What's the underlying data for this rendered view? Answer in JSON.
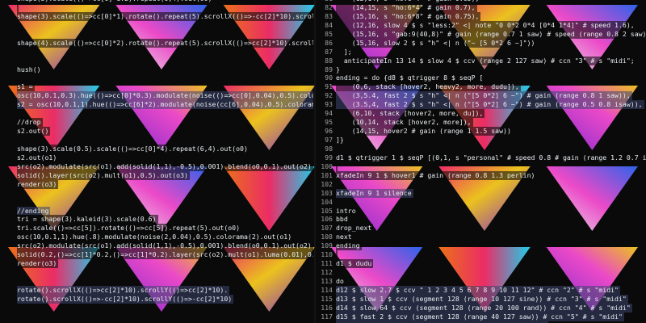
{
  "editor": {
    "left_lines": [
      {
        "n": "",
        "t": "shape(3).scale(()=>cc[0]*1.2).repeat(6,4).out(o0)"
      },
      {
        "n": "",
        "t": ""
      },
      {
        "n": "",
        "t": "shape(3).scale(()=>cc[0]*1).rotate().repeat(5).scrollX(()=>-cc[2]*10).scrollY(()=>-cc[2]*10).out(o0)"
      },
      {
        "n": "",
        "t": ""
      },
      {
        "n": "",
        "t": ""
      },
      {
        "n": "",
        "t": "shape(4).scale(()=>cc[0]*2).rotate().repeat(5).scrollX(()=>cc[2]*10).scrollY(()=>cc[2]*10).out()"
      },
      {
        "n": "",
        "t": ""
      },
      {
        "n": "",
        "t": ""
      },
      {
        "n": "",
        "t": "hush()"
      },
      {
        "n": "",
        "t": ""
      },
      {
        "n": "",
        "t": "s1 ="
      },
      {
        "n": "",
        "t": "osc(10,0.1,0.3).hue(()=>cc[0]*0.3).modulate(noise(()=>cc[0],0.04),0.5).colorama(0.5)"
      },
      {
        "n": "",
        "t": "s2 = osc(10,0.1,1).hue(()=>cc[6]*2).modulate(noise(cc[6],0.04),0.5).colorama(1)"
      },
      {
        "n": "",
        "t": ""
      },
      {
        "n": "",
        "t": "//drop"
      },
      {
        "n": "",
        "t": "s2.out()"
      },
      {
        "n": "",
        "t": ""
      },
      {
        "n": "",
        "t": "shape(3).scale(0.5).scale(()=>cc[0]*4).repeat(6,4).out(o0)"
      },
      {
        "n": "",
        "t": "s2.out(o1)"
      },
      {
        "n": "",
        "t": "src(o2).modulate(src(o1).add(solid(1,1),-0.5),0.001).blend(o0,0.1).out(o2)"
      },
      {
        "n": "",
        "t": "solid().layer(src(o2).mult(o1),0.5).out(o3)"
      },
      {
        "n": "",
        "t": "render(o3)"
      },
      {
        "n": "",
        "t": ""
      },
      {
        "n": "",
        "t": ""
      },
      {
        "n": "",
        "t": "//ending"
      },
      {
        "n": "",
        "t": "tri = shape(3).kaleid(3).scale(0.6)"
      },
      {
        "n": "",
        "t": "tri.scale(()=>cc[5]).rotate(()=>cc[5]).repeat(5).out(o0)"
      },
      {
        "n": "",
        "t": "osc(10,0.1,1).hue(.8).modulate(noise(2,0.04),0.5).colorama(2).out(o1)"
      },
      {
        "n": "",
        "t": "src(o2).modulate(src(o1).add(solid(1,1),-0.5),0.001).blend(o0,0.1).out(o2)"
      },
      {
        "n": "",
        "t": "solid(0.2,()=>cc[1]*0.2,()=>cc[1]*0.2).layer(src(o2).mult(o1).luma(0.01),0.1).out(o3)"
      },
      {
        "n": "",
        "t": "render(o3)"
      },
      {
        "n": "",
        "t": ""
      },
      {
        "n": "",
        "t": ""
      },
      {
        "n": "",
        "t": "rotate().scrollX(()=>cc[2]*10).scrollY(()=>cc[2]*10)."
      },
      {
        "n": "",
        "t": "rotate().scrollX(()=>-cc[2]*10).scrollY(()=>-cc[2]*10)"
      },
      {
        "n": "",
        "t": ""
      },
      {
        "n": "",
        "t": ""
      },
      {
        "n": "",
        "t": "hush()"
      }
    ],
    "right_lines": [
      {
        "n": "81",
        "t": "    (12,14, s \"ho:6*4\" # gain 0.65),"
      },
      {
        "n": "82",
        "t": "    (14,15, s \"ho:6*4\" # gain 0.7),"
      },
      {
        "n": "83",
        "t": "    (15,16, s \"ho:6*8\" # gain 0.75),"
      },
      {
        "n": "84",
        "t": "    (12,16, slow 4 $ s \"less:2\" <| note \"0 0*2 0*4 [0*4 1*4]\" # speed 1.6),"
      },
      {
        "n": "85",
        "t": "    (15,16, s \"gab:9(40,8)\" # gain (range 0.7 1 saw) # speed (range 0.8 2 saw) # cut 1),"
      },
      {
        "n": "86",
        "t": "    (15,16, slow 2 $ s \"h\" <| n (\"~ [5 0*2 6 ~]\"))"
      },
      {
        "n": "87",
        "t": "  ];"
      },
      {
        "n": "88",
        "t": "  anticipateIn 13 14 $ slow 4 $ ccv (range 2 127 saw) # ccn \"3\" # s \"midi\";"
      },
      {
        "n": "89",
        "t": "}"
      },
      {
        "n": "90",
        "t": "ending = do {d8 $ qtrigger 8 $ seqP ["
      },
      {
        "n": "91",
        "t": "    (0,6, stack [hover2, heavy2, more, dudu]),"
      },
      {
        "n": "92",
        "t": "    (3,5.4, fast 2 $ s \"h\" <| n (\"[5 0*2] 6 ~\") # gain (range 0.8 1 saw)),"
      },
      {
        "n": "93",
        "t": "    (3.5,4, fast 2 $ s \"h\" <| n (\"[5 0*2] 6 ~\") # gain (range 0.5 0.8 isaw)),"
      },
      {
        "n": "94",
        "t": "    (6,10, stack [hover2, more, du]),"
      },
      {
        "n": "95",
        "t": "    (10,14, stack [hover2, more]),"
      },
      {
        "n": "96",
        "t": "    (14,15, hover2 # gain (range 1 1.5 saw))"
      },
      {
        "n": "97",
        "t": "]}"
      },
      {
        "n": "98",
        "t": ""
      },
      {
        "n": "99",
        "t": "d1 $ qtrigger 1 $ seqP [(0,1, s \"personal\" # speed 0.8 # gain (range 1.2 0.7 isaw))]"
      },
      {
        "n": "100",
        "t": ""
      },
      {
        "n": "101",
        "t": "xfadeIn 9 1 $ hover1 # gain (range 0.8 1.3 perlin)"
      },
      {
        "n": "102",
        "t": ""
      },
      {
        "n": "103",
        "t": "xfadeIn 9 1 silence"
      },
      {
        "n": "104",
        "t": ""
      },
      {
        "n": "105",
        "t": "intro"
      },
      {
        "n": "106",
        "t": "bbd"
      },
      {
        "n": "107",
        "t": "drop_next"
      },
      {
        "n": "108",
        "t": "next"
      },
      {
        "n": "109",
        "t": "ending"
      },
      {
        "n": "110",
        "t": ""
      },
      {
        "n": "111",
        "t": "d1 $ dudu"
      },
      {
        "n": "112",
        "t": ""
      },
      {
        "n": "113",
        "t": "do"
      },
      {
        "n": "114",
        "t": "d12 $ slow 2.7 $ ccv \" 1 2 3 4 5 6 7 8 9 10 11 12\" # ccn \"2\" # s \"midi\""
      },
      {
        "n": "115",
        "t": "d13 $ slow 1 $ ccv (segment 128 (range 10 127 sine)) # ccn \"3\" # s \"midi\""
      },
      {
        "n": "116",
        "t": "d14 $ slow 64 $ ccv (segment 128 (range 20 100 rand)) # ccn \"4\" # s \"midi\""
      },
      {
        "n": "117",
        "t": "d15 $ fast 2 $ ccv (segment 128 (range 40 127 saw)) # ccn \"5\" # s \"midi\""
      },
      {
        "n": "118",
        "t": "d16 $ slow 2 $ ccv \"50 30 80 10\" # ccn \"6\" # s \"midi\""
      }
    ],
    "highlighted_left": [
      11,
      12,
      24,
      33,
      34
    ],
    "highlighted_right": [
      92,
      93,
      103,
      114,
      115,
      116,
      117,
      118
    ]
  },
  "visual": {
    "palette": [
      "#ff2f6e",
      "#ff7a1a",
      "#ffd21f",
      "#8a2be2",
      "#2f6bff",
      "#ff4fd8",
      "#ffffff",
      "#1fe0ff"
    ]
  }
}
